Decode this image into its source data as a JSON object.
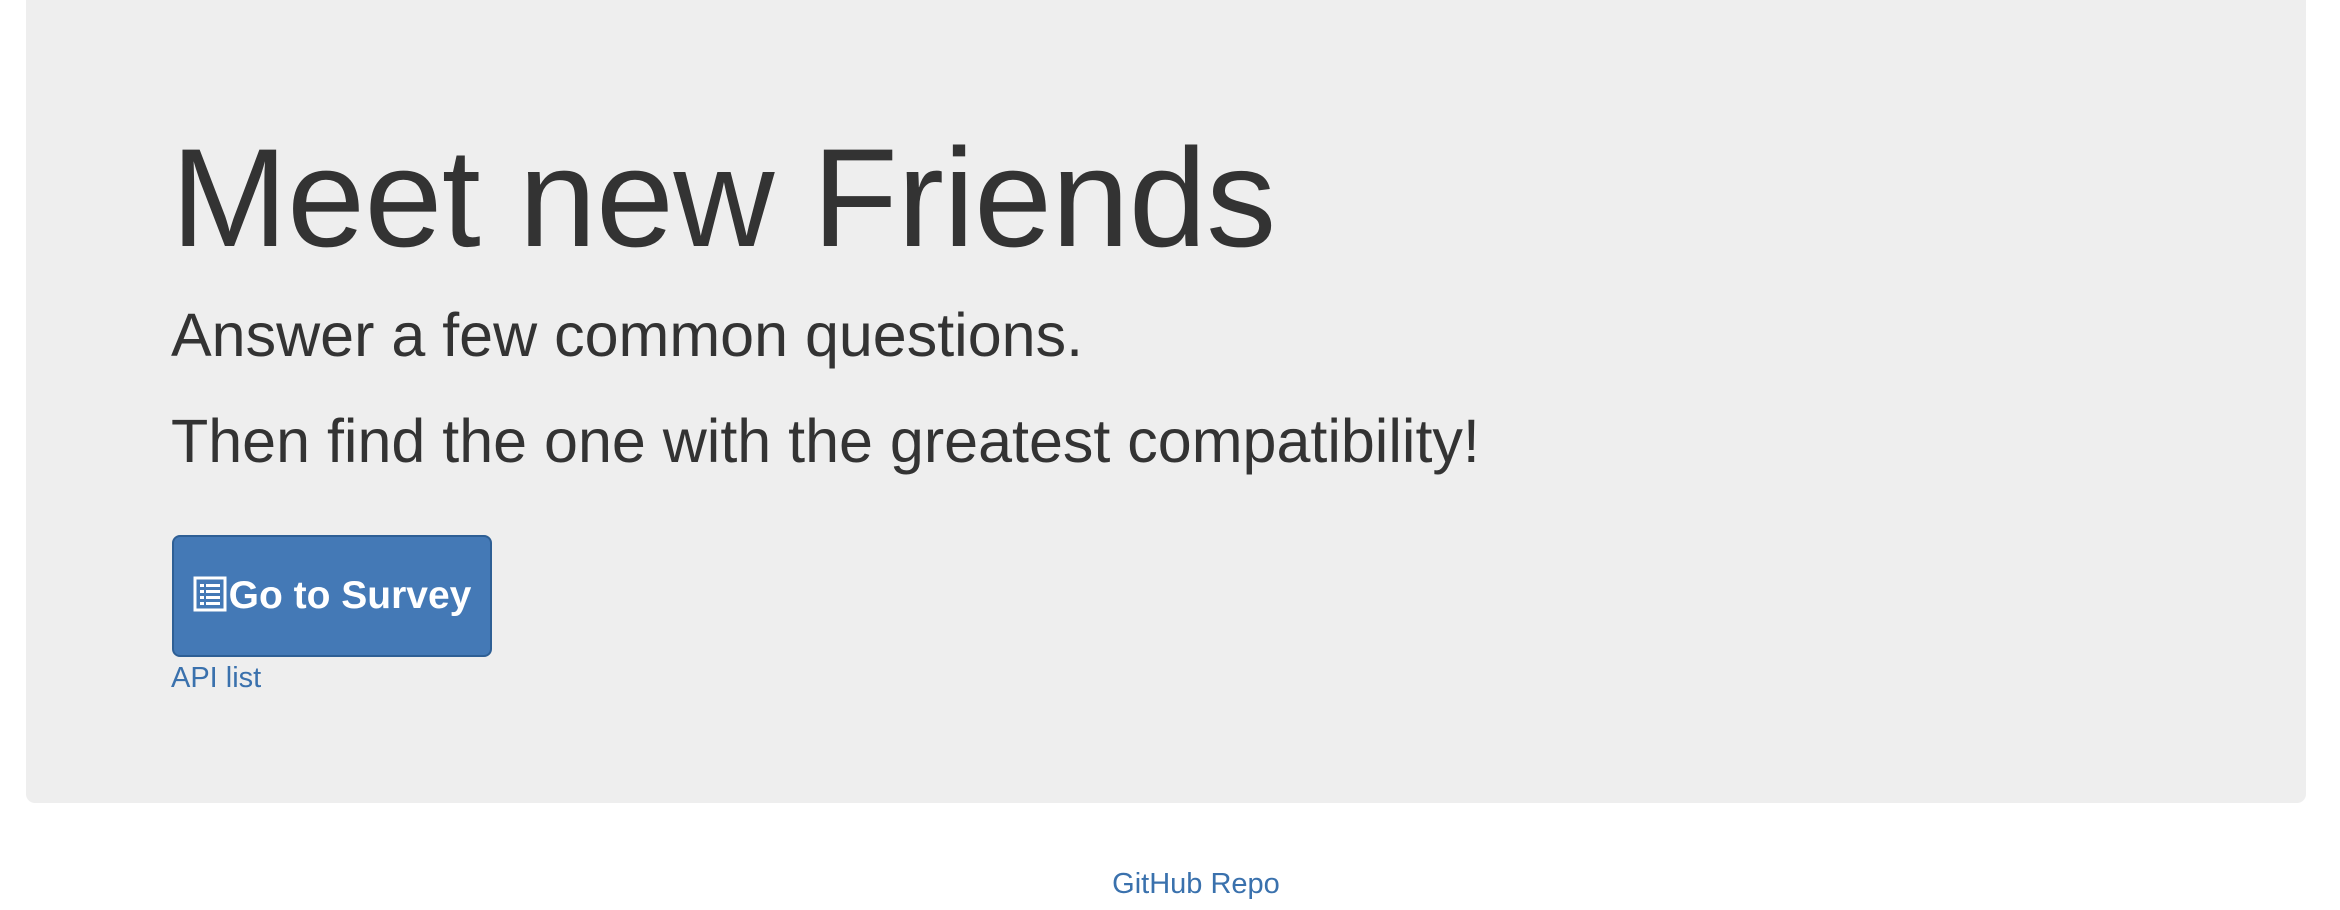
{
  "jumbotron": {
    "title": "Meet new Friends",
    "subtitle_1": "Answer a few common questions.",
    "subtitle_2": "Then find the one with the greatest compatibility!",
    "survey_button": {
      "label": "Go to Survey",
      "icon": "list-alt-icon"
    },
    "api_link": "API list"
  },
  "footer": {
    "repo_link": "GitHub Repo"
  },
  "colors": {
    "jumbotron_bg": "#eeeeee",
    "text": "#333333",
    "primary_button": "#4479b6",
    "link": "#3a71ad"
  }
}
